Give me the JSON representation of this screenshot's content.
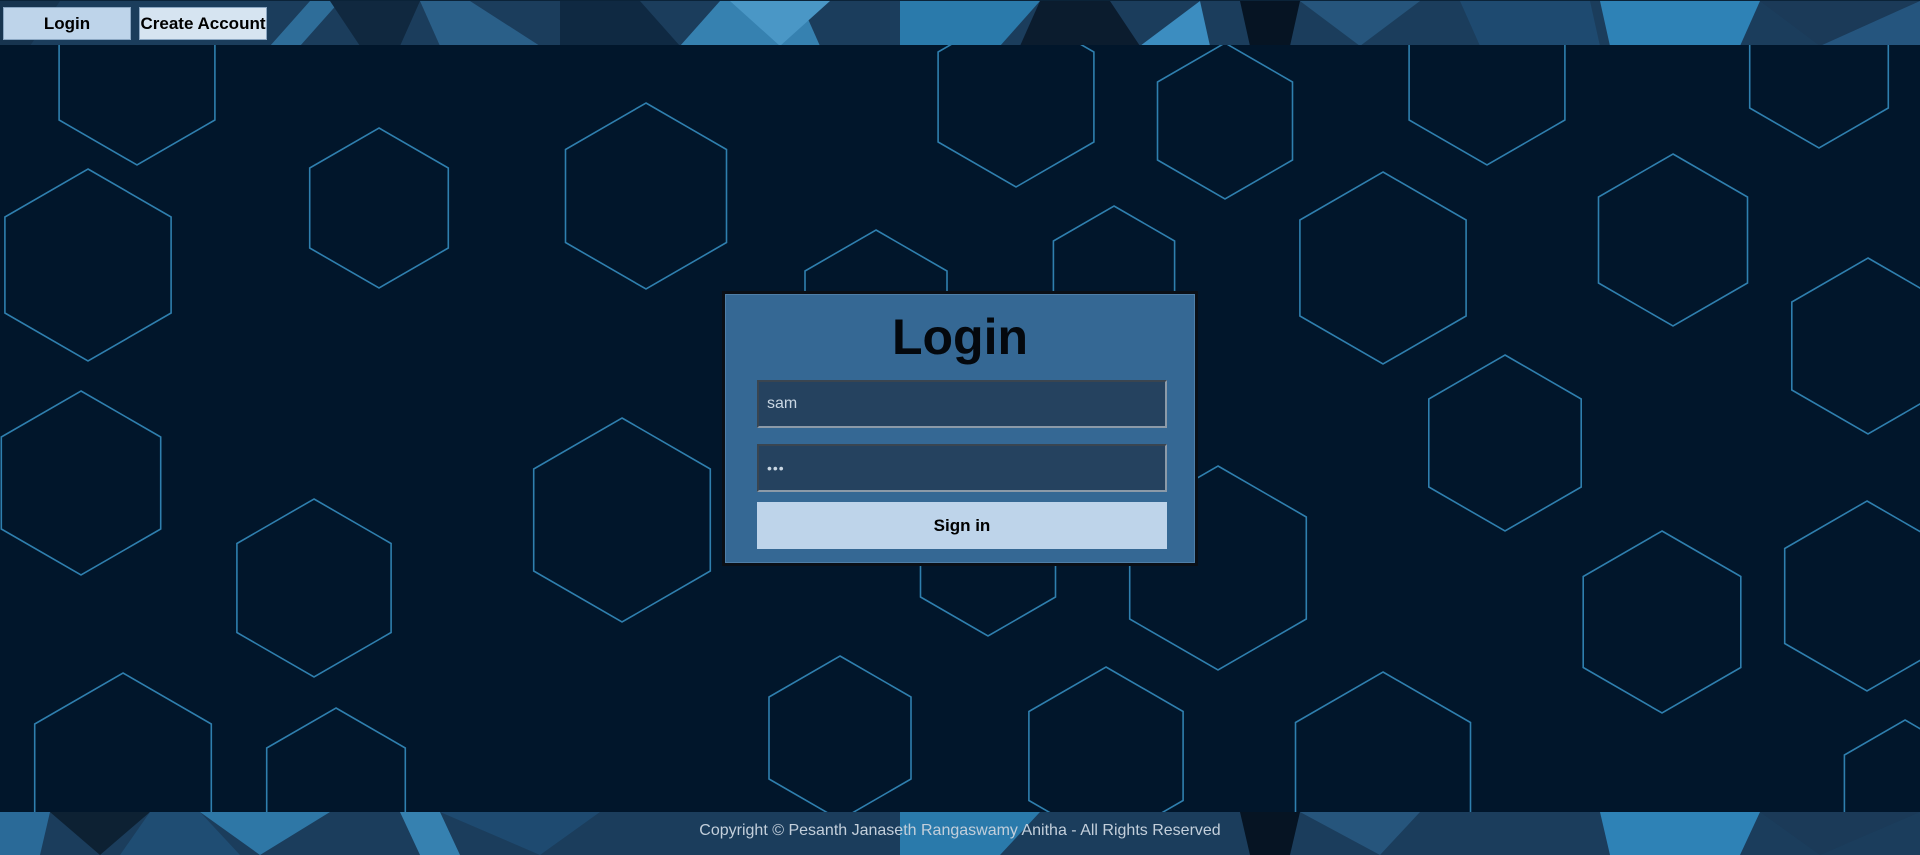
{
  "nav": {
    "login_label": "Login",
    "create_account_label": "Create Account"
  },
  "login_card": {
    "title": "Login",
    "username_value": "sam",
    "password_value": "•••",
    "signin_label": "Sign in"
  },
  "footer": {
    "copyright": "Copyright © Pesanth Janaseth Rangaswamy Anitha - All Rights Reserved"
  },
  "colors": {
    "page_background": "#01162b",
    "hexagon_stroke": "#2f7fae",
    "card_background": "#356894",
    "field_background": "#25425f",
    "button_background": "#bed4ea"
  }
}
